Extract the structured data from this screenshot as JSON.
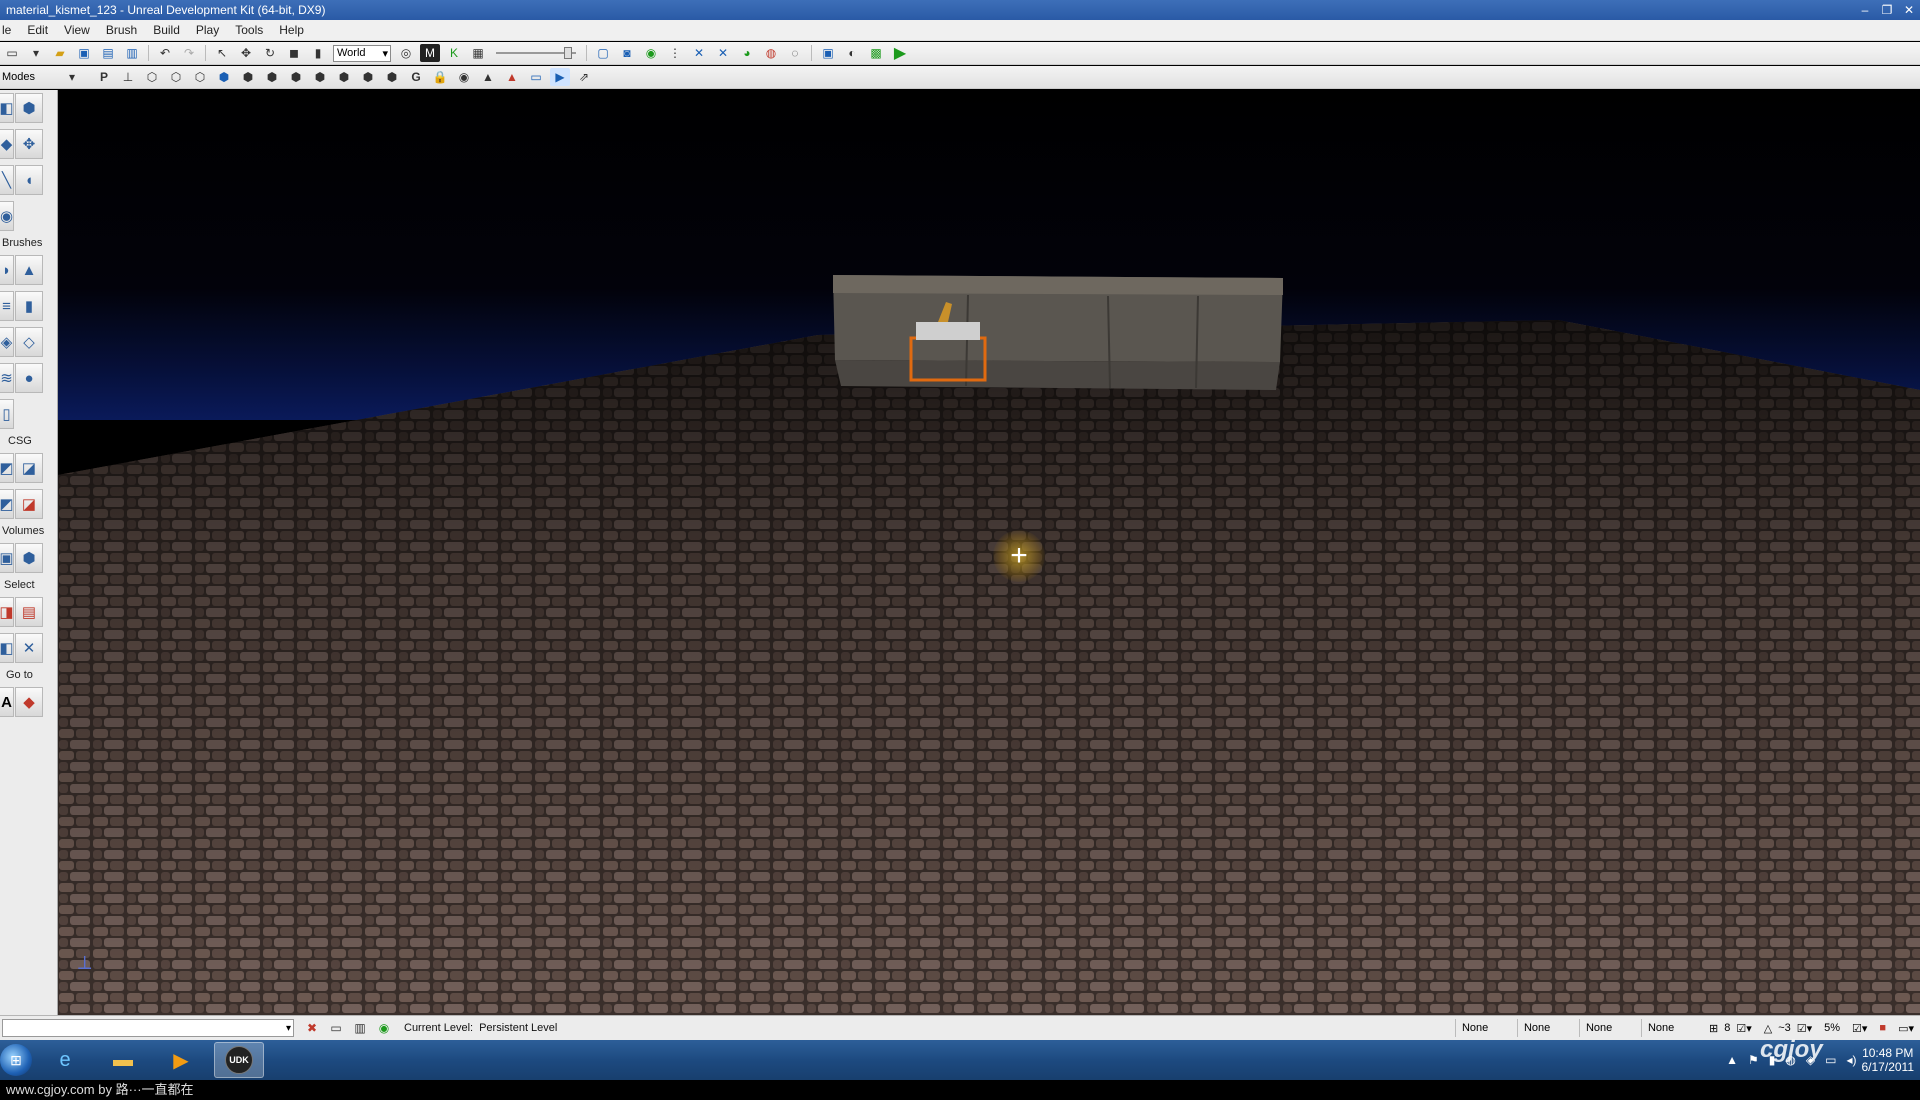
{
  "window": {
    "title": "material_kismet_123 - Unreal Development Kit (64-bit, DX9)",
    "minimize": "‒",
    "restore": "❐",
    "close": "✕"
  },
  "menus": [
    "le",
    "Edit",
    "View",
    "Brush",
    "Build",
    "Play",
    "Tools",
    "Help"
  ],
  "toolbar1": {
    "coord_system": "World"
  },
  "toolbar2": {
    "modes_label": "Modes",
    "p_label": "P",
    "g_label": "G"
  },
  "modes_panel": {
    "sections": {
      "brushes": "Brushes",
      "csg": "CSG",
      "volumes": "Volumes",
      "select": "Select",
      "goto": "Go to"
    },
    "goto_a": "A"
  },
  "status_bar": {
    "current_level_label": "Current Level:",
    "current_level_value": "Persistent Level",
    "slots": [
      "None",
      "None",
      "None",
      "None"
    ],
    "grid_value": "8",
    "rot_value": "~3",
    "scale_value": "5%"
  },
  "taskbar": {
    "udk_label": "UDK",
    "clock_time": "10:48 PM",
    "clock_date": "6/17/2011"
  },
  "watermark": "cgjoy",
  "caption": "www.cgjoy.com by 路···一直都在"
}
